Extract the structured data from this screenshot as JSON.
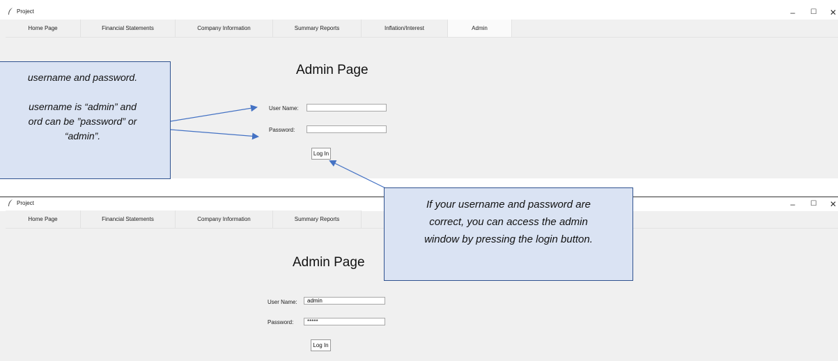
{
  "window1": {
    "title": "Project",
    "tabs": [
      {
        "label": "Home Page"
      },
      {
        "label": "Financial Statements"
      },
      {
        "label": "Company Information"
      },
      {
        "label": "Summary Reports"
      },
      {
        "label": "Inflation/Interest"
      },
      {
        "label": "Admin"
      }
    ],
    "active_tab": "Admin",
    "page_title": "Admin Page",
    "username_label": "User Name:",
    "username_value": "",
    "password_label": "Password:",
    "password_value": "",
    "login_label": "Log In"
  },
  "window2": {
    "title": "Project",
    "tabs": [
      {
        "label": "Home Page"
      },
      {
        "label": "Financial Statements"
      },
      {
        "label": "Company Information"
      },
      {
        "label": "Summary Reports"
      }
    ],
    "page_title": "Admin Page",
    "username_label": "User Name:",
    "username_value": "admin",
    "password_label": "Password:",
    "password_value": "*****",
    "login_label": "Log In"
  },
  "window_controls": {
    "minimize": "–",
    "maximize": "☐",
    "close": "✕"
  },
  "callouts": {
    "left_lines": [
      "username and password.",
      "",
      "username is “admin” and",
      "ord can be ”password” or",
      "“admin”."
    ],
    "right_lines": [
      "If your username and password are",
      "correct, you can access the admin",
      "window by pressing the login button."
    ]
  },
  "colors": {
    "callout_fill": "#dae3f3",
    "callout_border": "#2f528f",
    "arrow": "#4472c4"
  }
}
